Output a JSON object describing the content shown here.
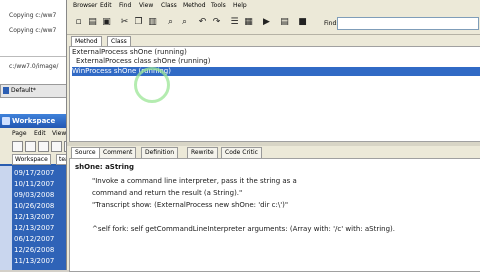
{
  "left_panel": {
    "lines": [
      "Copying c:/ww7",
      "Copying c:/ww7",
      "c:/ww7.0/image/"
    ],
    "default_label": "Default*"
  },
  "workspace": {
    "title": "Workspace",
    "menu": [
      "Page",
      "Edit",
      "View",
      "D"
    ],
    "tabs": [
      "Workspace",
      "tea"
    ],
    "rows": [
      "09/17/2007",
      "10/11/2007",
      "09/03/2008",
      "10/26/2008",
      "12/13/2007",
      "12/13/2007",
      "06/12/2007",
      "12/26/2008",
      "11/13/2007"
    ]
  },
  "browser": {
    "menu": [
      "Browser",
      "Edit",
      "Find",
      "View",
      "Class",
      "Method",
      "Tools",
      "Help"
    ],
    "find_label": "Find:",
    "find_value": "",
    "method_tabs": [
      "Method",
      "Class"
    ],
    "processes": [
      {
        "text": "ExternalProcess shOne  (running)",
        "selected": false
      },
      {
        "text": "ExternalProcess class shOne  (running)",
        "selected": false
      },
      {
        "text": "WinProcess shOne  (running)",
        "selected": true
      }
    ],
    "source_tabs": [
      "Source",
      "Comment",
      "Definition",
      "Rewrite",
      "Code Critic"
    ],
    "code": {
      "signature": "shOne: aString",
      "lines": [
        "\"Invoke a command line interpreter, pass it the string as a",
        "command and return the result (a String).\"",
        "\"Transcript show: (ExternalProcess new shOne: 'dir c:\\')\"",
        "",
        "^self fork: self getCommandLineInterpreter arguments: (Array with: '/c' with: aString)."
      ]
    }
  },
  "colors": {
    "selection": "#316ac5",
    "workspace_blue": "#2f63b7",
    "chrome": "#ece9d8"
  }
}
